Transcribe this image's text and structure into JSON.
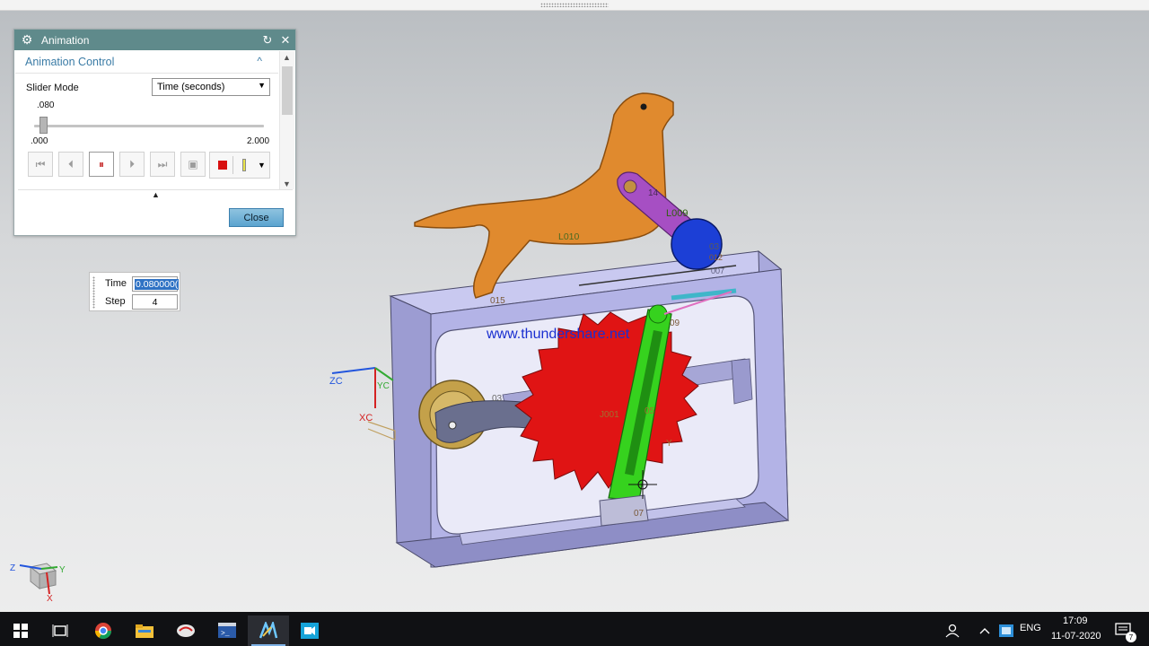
{
  "dialog": {
    "title": "Animation",
    "group_title": "Animation Control",
    "slider_mode_label": "Slider Mode",
    "slider_mode_value": "Time (seconds)",
    "slider_current": ".080",
    "slider_min": ".000",
    "slider_max": "2.000",
    "slider_fraction": 0.04,
    "close_label": "Close"
  },
  "time_step": {
    "time_label": "Time",
    "time_value": "0.080000(",
    "step_label": "Step",
    "step_value": "4"
  },
  "model_labels": {
    "watermark": "www.thundershare.net",
    "link_l010": "L010",
    "link_l009": "L009",
    "link_14": "14",
    "label_03": "03",
    "label_012": "012",
    "label_007": "007",
    "label_015": "015",
    "label_09": "09",
    "label_j001": "J001",
    "label_05": "05",
    "label_07": "07",
    "label_y": "Y",
    "axis_zc": "ZC",
    "axis_yc": "YC",
    "axis_xc": "XC",
    "triad_z": "Z",
    "triad_y": "Y",
    "triad_x": "X"
  },
  "taskbar": {
    "language": "ENG",
    "time": "17:09",
    "date": "11-07-2020",
    "notification_count": "7"
  },
  "colors": {
    "dialog_title_bg": "#5f8a8b",
    "group_text": "#3b7ca6",
    "frame": "#b3b3e6",
    "dog": "#e08a2e",
    "gear": "#e01414",
    "green_link": "#36d21e",
    "purple_link": "#a64fc3",
    "blue_wheel": "#1c3fd6",
    "watermark": "#1a2fd0"
  }
}
